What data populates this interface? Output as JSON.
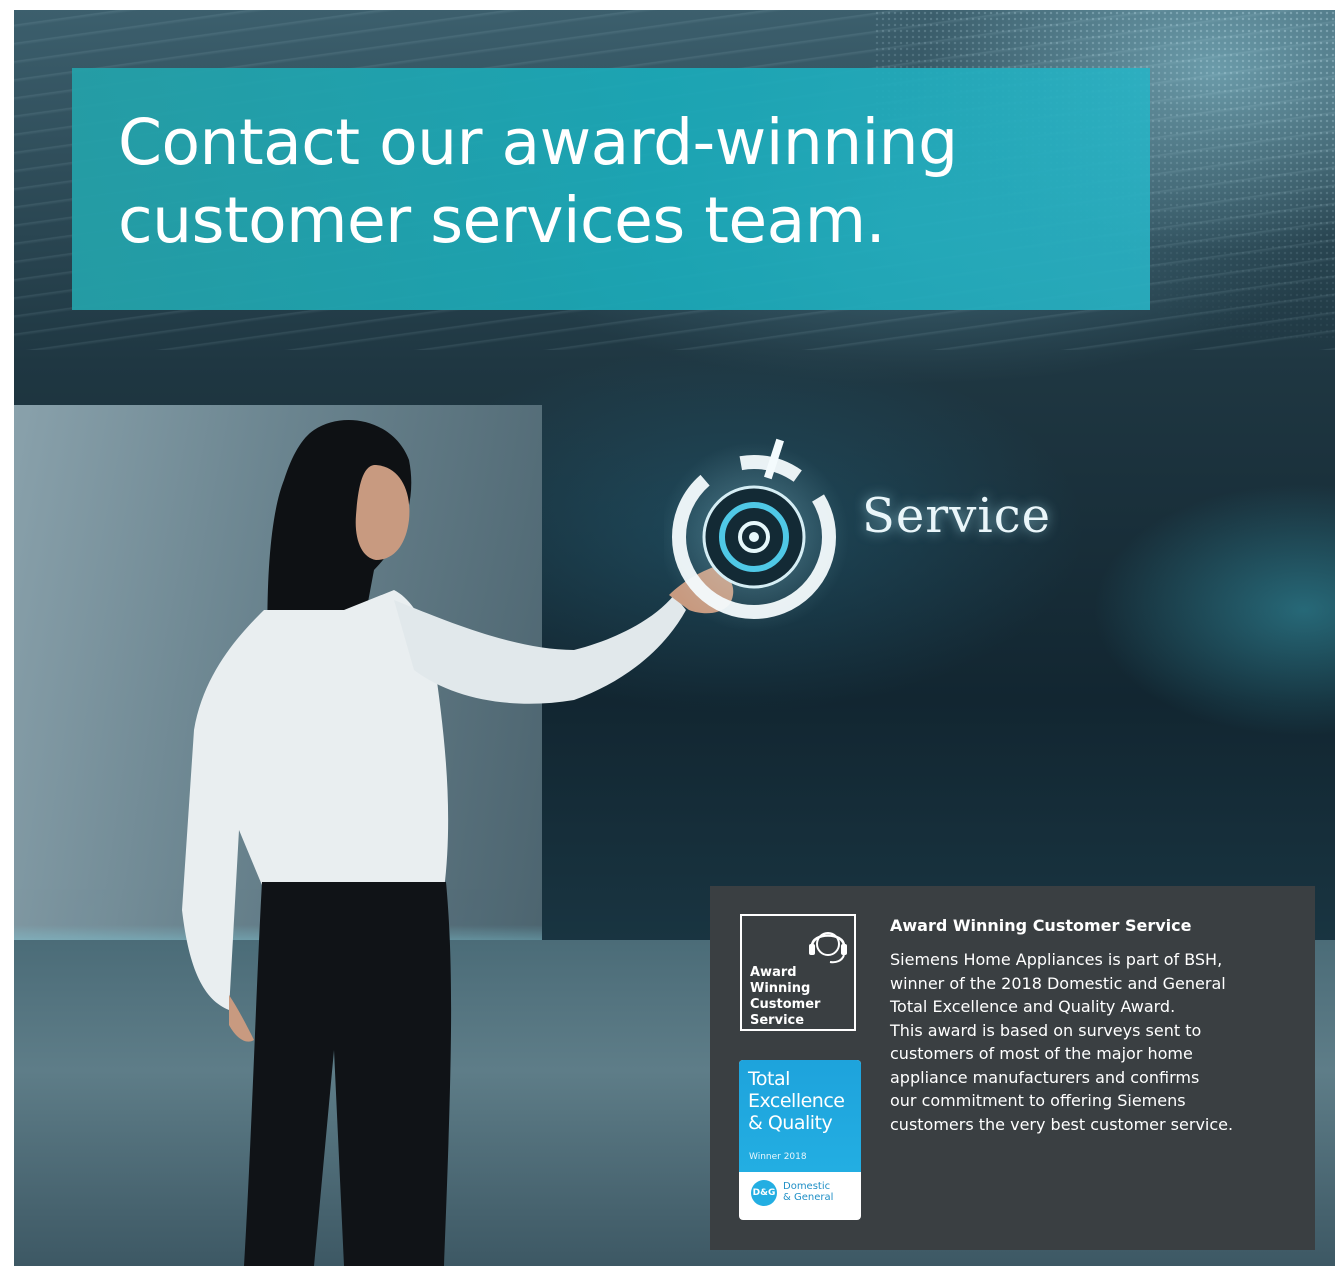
{
  "banner": {
    "headline_line1": "Contact our award-winning",
    "headline_line2": "customer services team."
  },
  "hero": {
    "service_label": "Service"
  },
  "award": {
    "badge_lines": [
      "Award",
      "Winning",
      "Customer",
      "Service"
    ],
    "teq_badge": {
      "title_lines": [
        "Total",
        "Excellence",
        "& Quality"
      ],
      "winner": "Winner 2018",
      "logo_mark": "D&G",
      "logo_name_lines": [
        "Domestic",
        "& General"
      ]
    },
    "heading": "Award Winning Customer Service",
    "body_lines": [
      "Siemens Home Appliances is part of BSH,",
      "winner of the 2018 Domestic and General",
      "Total Excellence and Quality Award.",
      "This award is based on surveys sent to",
      "customers of most of the major home",
      "appliance manufacturers and confirms",
      "our commitment to offering Siemens",
      "customers the very best customer service."
    ]
  },
  "colors": {
    "banner_teal": "#1aa9b9",
    "panel_dark": "#3a3f42",
    "badge_blue": "#23aee2"
  }
}
